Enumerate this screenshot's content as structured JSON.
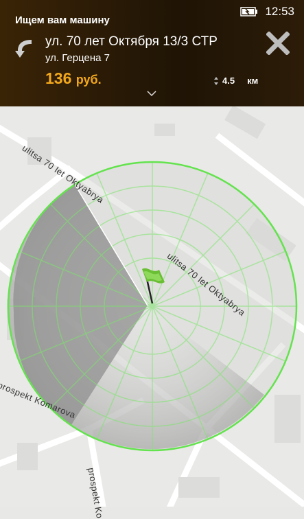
{
  "header": {
    "title": "Ищем вам машину",
    "clock": "12:53",
    "from": "ул. 70 лет Октября 13/3 СТР",
    "to": "ул. Герцена 7",
    "price_value": "136",
    "price_unit": "руб.",
    "distance_value": "4.5",
    "distance_unit": "км"
  },
  "map": {
    "street_labels": [
      "ulitsa 70 let Oktyabrya",
      "ulitsa 70 let Oktyabrya",
      "prospekt Komarova",
      "prospekt Ko"
    ]
  },
  "colors": {
    "accent": "#f3a81c",
    "radar": "#6ee85a",
    "header_bg": "#2a1a06"
  },
  "icons": [
    "back-arrow-icon",
    "close-icon",
    "battery-icon",
    "chevron-down-icon",
    "flag-icon",
    "distance-arrows-icon"
  ]
}
